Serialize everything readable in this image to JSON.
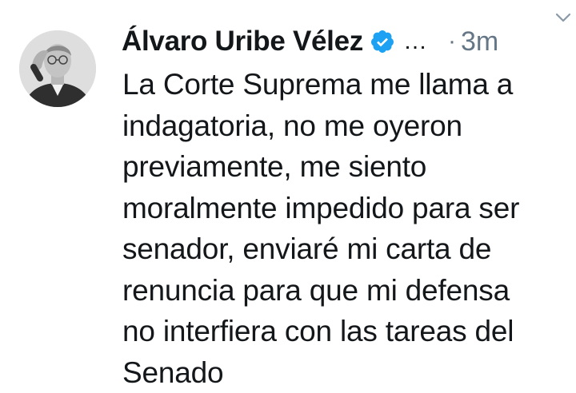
{
  "tweet": {
    "author_name": "Álvaro Uribe Vélez",
    "verified_icon": "verified-badge-icon",
    "truncation": "…",
    "separator": "·",
    "timestamp": "3m",
    "menu_icon": "chevron-down-icon",
    "avatar_icon": "profile-photo",
    "text_lines": [
      "La Corte Suprema me llama a",
      "indagatoria, no me oyeron",
      "previamente, me siento",
      "moralmente impedido para ser",
      "senador, enviaré mi carta de",
      "renuncia para que mi defensa",
      "no interfiera con las tareas del",
      "Senado"
    ]
  },
  "colors": {
    "text": "#14171a",
    "muted": "#657786",
    "verified": "#1da1f2",
    "background": "#ffffff"
  }
}
